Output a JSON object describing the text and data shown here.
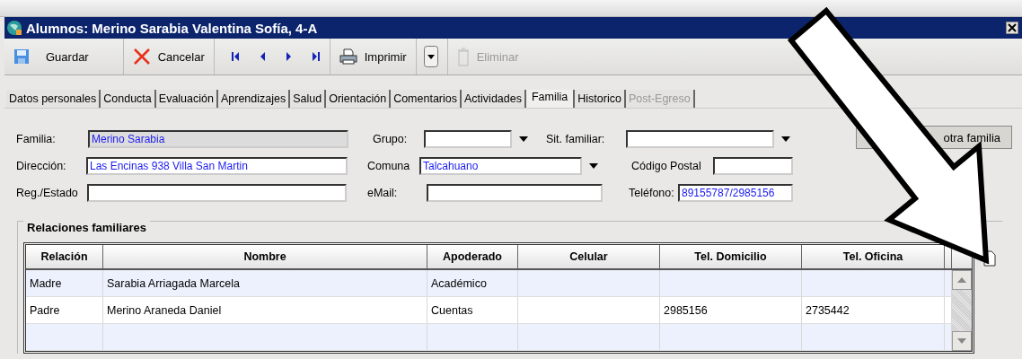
{
  "window": {
    "title": "Alumnos: Merino Sarabia Valentina Sofía, 4-A"
  },
  "toolbar": [
    {
      "kind": "save",
      "label": "Guardar",
      "disabled": false
    },
    {
      "kind": "cancel",
      "label": "Cancelar",
      "disabled": false
    },
    {
      "kind": "nav"
    },
    {
      "kind": "print",
      "label": "Imprimir",
      "disabled": false
    },
    {
      "kind": "menu"
    },
    {
      "kind": "delete",
      "label": "Eliminar",
      "disabled": true
    }
  ],
  "tabs": [
    {
      "label": "Datos personales",
      "selected": false,
      "disabled": false
    },
    {
      "label": "Conducta",
      "selected": false,
      "disabled": false
    },
    {
      "label": "Evaluación",
      "selected": false,
      "disabled": false
    },
    {
      "label": "Aprendizajes",
      "selected": false,
      "disabled": false
    },
    {
      "label": "Salud",
      "selected": false,
      "disabled": false
    },
    {
      "label": "Orientación",
      "selected": false,
      "disabled": false
    },
    {
      "label": "Comentarios",
      "selected": false,
      "disabled": false
    },
    {
      "label": "Actividades",
      "selected": false,
      "disabled": false
    },
    {
      "label": "Familia",
      "selected": true,
      "disabled": false
    },
    {
      "label": "Historico",
      "selected": false,
      "disabled": false
    },
    {
      "label": "Post-Egreso",
      "selected": false,
      "disabled": true
    }
  ],
  "form": {
    "rows": [
      [
        {
          "label": "Familia:",
          "value": "Merino Sarabia",
          "kind": "text",
          "readonly": true
        },
        {
          "label": "Grupo:",
          "kind": "combo"
        },
        {
          "label": "Sit. familiar:",
          "kind": "combo"
        }
      ],
      [
        {
          "label": "Dirección:",
          "value": "Las Encinas 938 Villa San Martin",
          "kind": "text"
        },
        {
          "label": "Comuna",
          "value": "Talcahuano",
          "kind": "combo"
        },
        {
          "label": "Código Postal",
          "kind": "text"
        }
      ],
      [
        {
          "label": "Reg./Estado",
          "kind": "text"
        },
        {
          "label": "eMail:",
          "kind": "text"
        },
        {
          "label": "Teléfono:",
          "value": "89155787/2985156",
          "kind": "text"
        }
      ]
    ],
    "side_button": "otra familia"
  },
  "relations": {
    "title": "Relaciones familiares",
    "columns": [
      "Relación",
      "Nombre",
      "Apoderado",
      "Celular",
      "Tel. Domicilio",
      "Tel. Oficina"
    ],
    "rows": [
      [
        "Madre",
        "Sarabia Arriagada Marcela",
        "Académico",
        "",
        "",
        ""
      ],
      [
        "Padre",
        "Merino Araneda Daniel",
        "Cuentas",
        "",
        "2985156",
        "2735442"
      ],
      [
        "",
        "",
        "",
        "",
        "",
        ""
      ]
    ]
  }
}
